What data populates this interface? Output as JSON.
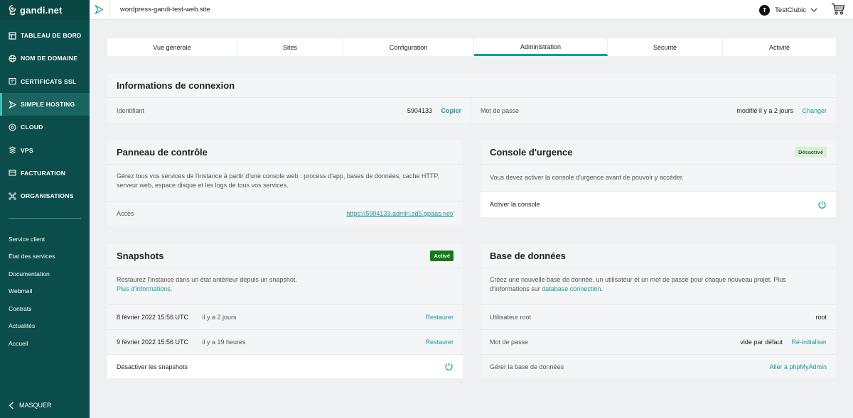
{
  "brand": {
    "name": "gandi.net"
  },
  "sidebar": {
    "items": [
      {
        "label": "TABLEAU DE BORD",
        "icon": "dashboard-icon"
      },
      {
        "label": "NOM DE DOMAINE",
        "icon": "globe-icon"
      },
      {
        "label": "CERTIFICATS SSL",
        "icon": "certificate-icon"
      },
      {
        "label": "SIMPLE HOSTING",
        "icon": "hosting-icon",
        "active": true
      },
      {
        "label": "CLOUD",
        "icon": "cloud-icon"
      },
      {
        "label": "VPS",
        "icon": "server-icon"
      },
      {
        "label": "FACTURATION",
        "icon": "card-icon"
      },
      {
        "label": "ORGANISATIONS",
        "icon": "organisation-icon"
      }
    ],
    "links": [
      "Service client",
      "État des services",
      "Documentation",
      "Webmail",
      "Contrats",
      "Actualités",
      "Accueil"
    ],
    "hide_label": "MASQUER"
  },
  "topbar": {
    "site": "wordpress-gandi-test-web.site",
    "user": {
      "initial": "T",
      "name": "TestClubic"
    }
  },
  "tabs": [
    {
      "label": "Vue générale"
    },
    {
      "label": "Sites"
    },
    {
      "label": "Configuration"
    },
    {
      "label": "Administration",
      "active": true
    },
    {
      "label": "Sécurité"
    },
    {
      "label": "Activité"
    }
  ],
  "connexion": {
    "title": "Informations de connexion",
    "login_label": "Identifiant",
    "login_value": "5904133",
    "copy_label": "Copier",
    "password_label": "Mot de passe",
    "password_value": "modifié il y a 2 jours",
    "change_label": "Changer"
  },
  "panel": {
    "title": "Panneau de contrôle",
    "description": "Gérez tous vos services de l'instance à partir d'une console web : process d'app, bases de données, cache HTTP, serveur web, espace disque et les logs de tous vos services.",
    "access_label": "Accès",
    "access_url": "https://5904133.admin.sd5.gpaas.net/"
  },
  "console": {
    "title": "Console d'urgence",
    "badge": "Désactivé",
    "description": "Vous devez activer la console d'urgence avant de pouvoir y accéder.",
    "activate_label": "Activer la console"
  },
  "snapshots": {
    "title": "Snapshots",
    "badge": "Activé",
    "description": "Restaurez l'instance dans un état antérieur depuis un snapshot.",
    "more_link": "Plus d'informations",
    "more_suffix": ".",
    "rows": [
      {
        "date": "8 février 2022 15:56 UTC",
        "ago": "il y a 2 jours",
        "action": "Restaurer"
      },
      {
        "date": "9 février 2022 15:56 UTC",
        "ago": "il y a 19 heures",
        "action": "Restaurer"
      }
    ],
    "disable_label": "Désactiver les snapshots"
  },
  "database": {
    "title": "Base de données",
    "description": "Créez une nouvelle base de donnée, un utilisateur et un mot de passe pour chaque nouveau projet. Plus d'informations sur",
    "db_link": "database connection",
    "db_suffix": ".",
    "root_label": "Utilisateur root",
    "root_value": "root",
    "password_label": "Mot de passe",
    "password_value": "vide par défaut",
    "reset_label": "Ré-initialiser",
    "manage_label": "Gérer la base de données",
    "phpmyadmin_label": "Aller à phpMyAdmin"
  },
  "colors": {
    "sidebar": "#0b4d4a",
    "accent": "#1a9a9a",
    "active_badge": "#147a18"
  }
}
